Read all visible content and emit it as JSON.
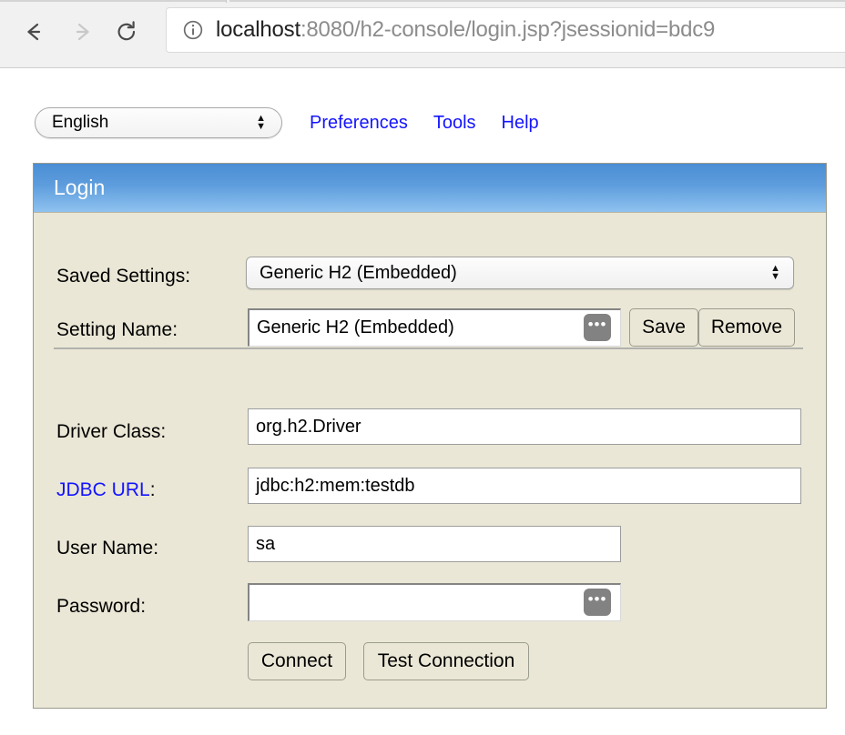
{
  "browser": {
    "back_icon": "arrow-left-icon",
    "forward_icon": "arrow-right-icon",
    "reload_icon": "reload-icon",
    "info_icon": "info-circle-icon",
    "url_host": "localhost",
    "url_rest": ":8080/h2-console/login.jsp?jsessionid=bdc9"
  },
  "toolbar": {
    "language_selected": "English",
    "links": [
      {
        "label": "Preferences"
      },
      {
        "label": "Tools"
      },
      {
        "label": "Help"
      }
    ]
  },
  "panel": {
    "title": "Login",
    "rows": {
      "saved_settings": {
        "label": "Saved Settings:",
        "value": "Generic H2 (Embedded)"
      },
      "setting_name": {
        "label": "Setting Name:",
        "value": "Generic H2 (Embedded)",
        "dots_icon": "ellipsis-button-icon",
        "save_label": "Save",
        "remove_label": "Remove"
      },
      "driver_class": {
        "label": "Driver Class:",
        "value": "org.h2.Driver"
      },
      "jdbc_url": {
        "label": "JDBC URL",
        "colon": ":",
        "value": "jdbc:h2:mem:testdb"
      },
      "user_name": {
        "label": "User Name:",
        "value": "sa"
      },
      "password": {
        "label": "Password:",
        "value": "",
        "dots_icon": "ellipsis-button-icon"
      }
    },
    "actions": {
      "connect_label": "Connect",
      "test_label": "Test Connection"
    }
  },
  "colors": {
    "link_blue": "#1414ff",
    "panel_bg": "#eae7d6",
    "header_blue_top": "#4a8ed4",
    "header_blue_bottom": "#8ec2ef",
    "dots_gray": "#828282"
  }
}
